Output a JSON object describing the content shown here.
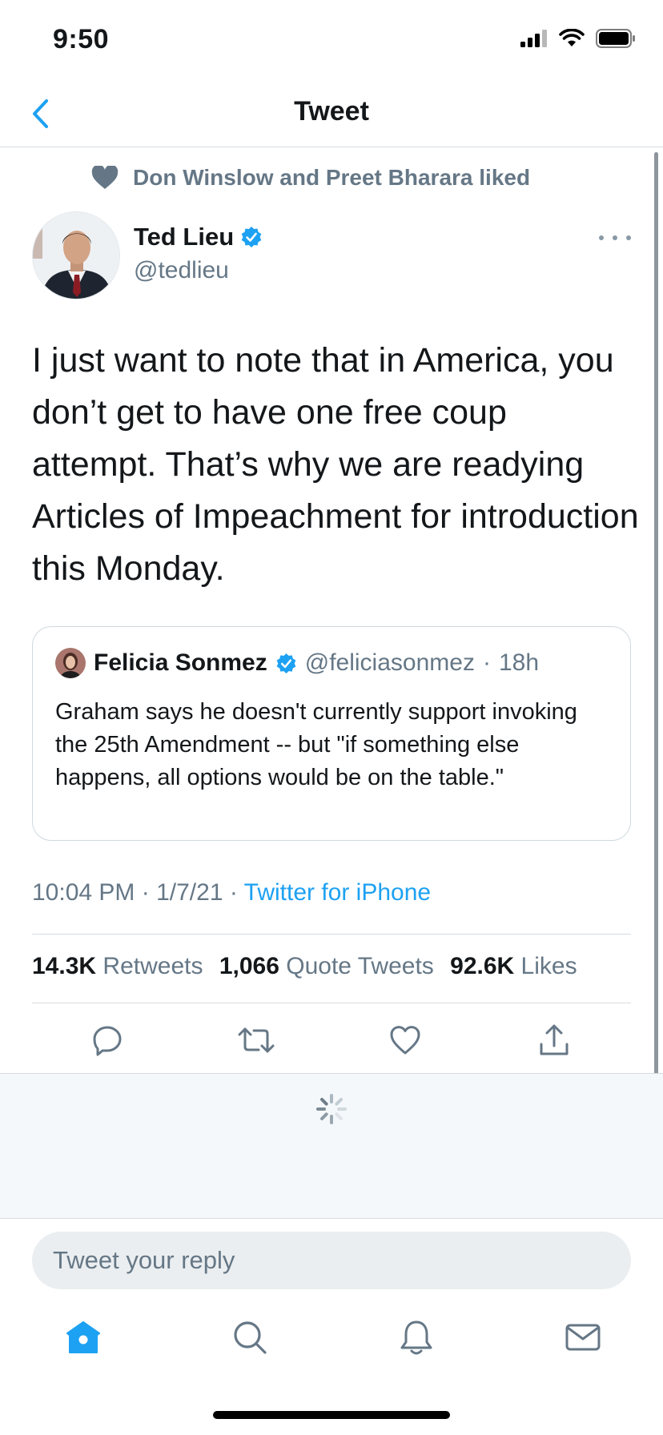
{
  "status_bar": {
    "time": "9:50"
  },
  "nav": {
    "title": "Tweet"
  },
  "social_context": {
    "text": "Don Winslow and Preet Bharara liked"
  },
  "tweet": {
    "author_name": "Ted Lieu",
    "author_handle": "@tedlieu",
    "text": "I just want to note that in America, you don’t get to have one free coup attempt. That’s why we are readying Articles of Impeachment for introduction this Monday.",
    "time": "10:04 PM",
    "date": "1/7/21",
    "source": "Twitter for iPhone"
  },
  "quoted_tweet": {
    "author_name": "Felicia Sonmez",
    "author_handle": "@feliciasonmez",
    "age": "18h",
    "text": "Graham says he doesn't currently support invoking the 25th Amendment -- but \"if something else happens, all options would be on the table.\""
  },
  "stats": {
    "retweets_count": "14.3K",
    "retweets_label": "Retweets",
    "quotes_count": "1,066",
    "quotes_label": "Quote Tweets",
    "likes_count": "92.6K",
    "likes_label": "Likes"
  },
  "actions": [
    "reply-icon",
    "retweet-icon",
    "like-icon",
    "share-icon"
  ],
  "reply": {
    "placeholder": "Tweet your reply"
  },
  "tabs": [
    "home-icon",
    "search-icon",
    "notifications-icon",
    "messages-icon"
  ],
  "colors": {
    "accent": "#1DA1F2",
    "secondary_text": "#657786",
    "verified": "#1DA1F2"
  }
}
